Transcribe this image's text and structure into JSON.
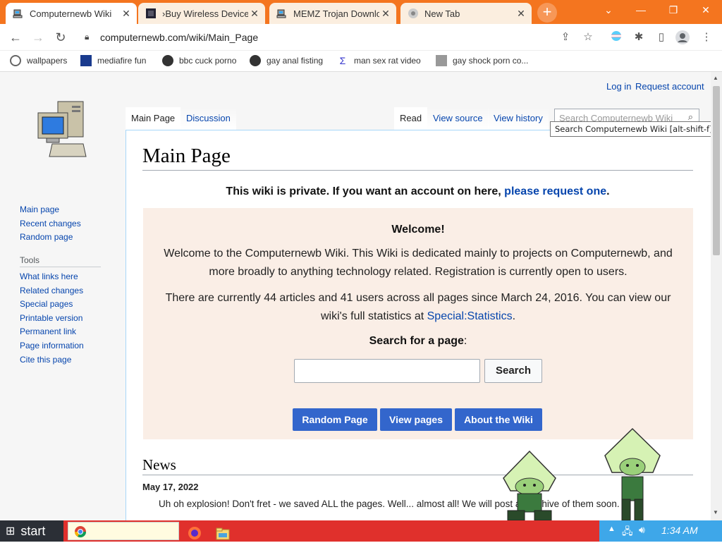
{
  "browser": {
    "tabs": [
      {
        "title": "Computernewb Wiki",
        "active": true
      },
      {
        "title": "›Buy Wireless Device",
        "active": false
      },
      {
        "title": "MEMZ Trojan Downlo",
        "active": false
      },
      {
        "title": "New Tab",
        "active": false
      }
    ],
    "url": "computernewb.com/wiki/Main_Page",
    "bookmarks": [
      {
        "label": "wallpapers"
      },
      {
        "label": "mediafire fun"
      },
      {
        "label": "bbc cuck porno"
      },
      {
        "label": "gay anal fisting"
      },
      {
        "label": "man sex rat video"
      },
      {
        "label": "gay shock porn co..."
      }
    ],
    "accent": "#f4751f"
  },
  "wiki": {
    "personal": {
      "login": "Log in",
      "request": "Request account"
    },
    "sidebar": {
      "main": [
        "Main page",
        "Recent changes",
        "Random page"
      ],
      "tools_heading": "Tools",
      "tools": [
        "What links here",
        "Related changes",
        "Special pages",
        "Printable version",
        "Permanent link",
        "Page information",
        "Cite this page"
      ]
    },
    "tabs": {
      "main_page": "Main Page",
      "discussion": "Discussion",
      "read": "Read",
      "view_source": "View source",
      "view_history": "View history"
    },
    "search": {
      "placeholder": "Search Computernewb Wiki",
      "tooltip": "Search Computernewb Wiki [alt-shift-f]"
    },
    "title": "Main Page",
    "notice": {
      "text": "This wiki is private. If you want an account on here, ",
      "link": "please request one",
      "end": "."
    },
    "welcome": {
      "title": "Welcome!",
      "para1": "Welcome to the Computernewb Wiki. This Wiki is dedicated mainly to projects on Computernewb, and more broadly to anything technology related. Registration is currently open to users.",
      "para2_text": "There are currently 44 articles and 41 users across all pages since March 24, 2016. You can view our wiki's full statistics at ",
      "para2_link": "Special:Statistics",
      "para2_end": ".",
      "search_label": "Search for a page",
      "search_colon": ":",
      "search_button": "Search",
      "buttons": [
        "Random Page",
        "View pages",
        "About the Wiki"
      ]
    },
    "news": {
      "heading": "News",
      "date": "May 17, 2022",
      "text": "Uh oh explosion! Don't fret - we saved ALL the pages. Well... almost all! We will post an archive of them soon."
    }
  },
  "taskbar": {
    "start": "start",
    "clock": "1:34 AM"
  }
}
